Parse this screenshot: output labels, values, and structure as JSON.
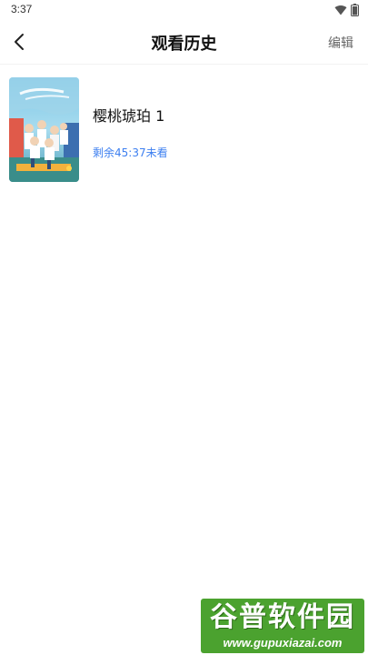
{
  "status_bar": {
    "time": "3:37",
    "icons": [
      "wifi-icon",
      "battery-icon"
    ]
  },
  "nav": {
    "back_icon": "chevron-left-icon",
    "title": "观看历史",
    "edit_label": "编辑"
  },
  "history": [
    {
      "title": "樱桃琥珀 1",
      "progress_text": "剩余45:37未看",
      "poster_icon": "poster-image"
    }
  ],
  "colors": {
    "accent": "#3d7ff0",
    "watermark": "#4ba22f"
  },
  "watermark": {
    "name": "谷普软件园",
    "url": "www.gupuxiazai.com"
  }
}
